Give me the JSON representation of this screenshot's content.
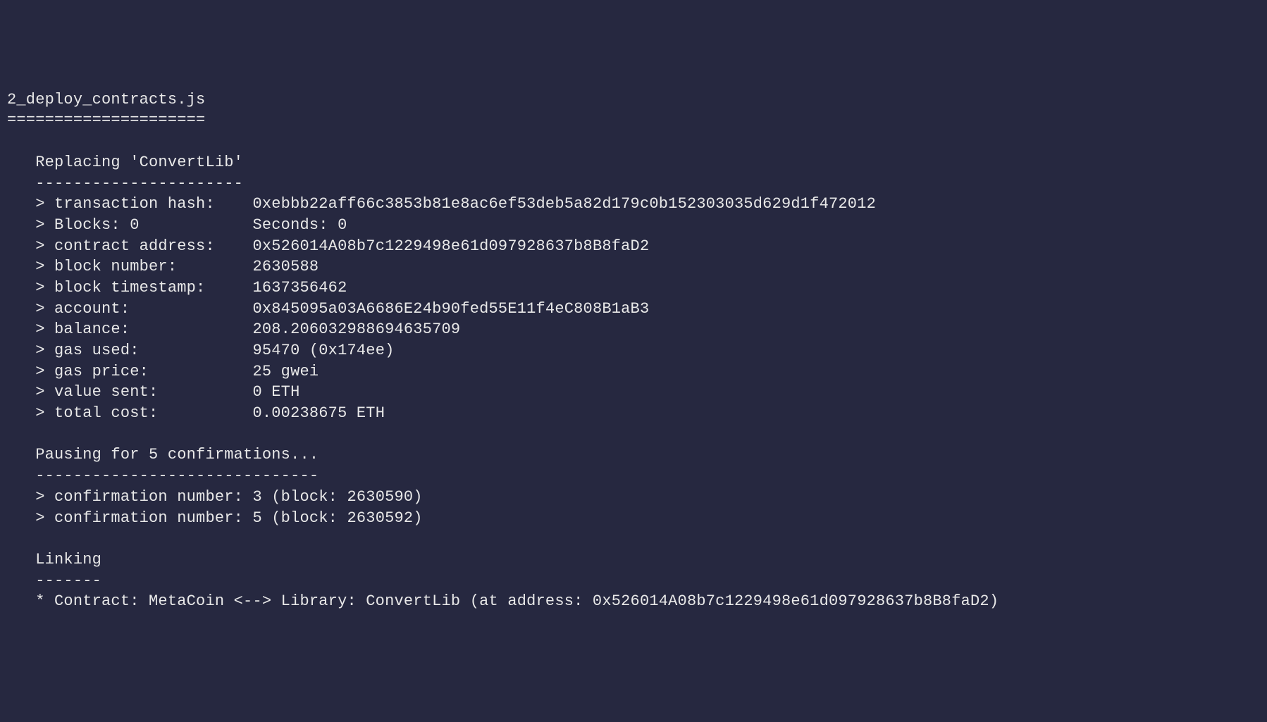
{
  "header": {
    "filename": "2_deploy_contracts.js",
    "underline": "====================="
  },
  "section_replacing": {
    "title": "   Replacing 'ConvertLib'",
    "underline": "   ----------------------",
    "rows": [
      {
        "label": "   > transaction hash:    ",
        "value": "0xebbb22aff66c3853b81e8ac6ef53deb5a82d179c0b152303035d629d1f472012"
      },
      {
        "label": "   > Blocks: 0            ",
        "value": "Seconds: 0"
      },
      {
        "label": "   > contract address:    ",
        "value": "0x526014A08b7c1229498e61d097928637b8B8faD2"
      },
      {
        "label": "   > block number:        ",
        "value": "2630588"
      },
      {
        "label": "   > block timestamp:     ",
        "value": "1637356462"
      },
      {
        "label": "   > account:             ",
        "value": "0x845095a03A6686E24b90fed55E11f4eC808B1aB3"
      },
      {
        "label": "   > balance:             ",
        "value": "208.206032988694635709"
      },
      {
        "label": "   > gas used:            ",
        "value": "95470 (0x174ee)"
      },
      {
        "label": "   > gas price:           ",
        "value": "25 gwei"
      },
      {
        "label": "   > value sent:          ",
        "value": "0 ETH"
      },
      {
        "label": "   > total cost:          ",
        "value": "0.00238675 ETH"
      }
    ]
  },
  "section_pausing": {
    "title": "   Pausing for 5 confirmations...",
    "underline": "   ------------------------------",
    "rows": [
      {
        "label": "   > confirmation number: ",
        "value": "3 (block: 2630590)"
      },
      {
        "label": "   > confirmation number: ",
        "value": "5 (block: 2630592)"
      }
    ]
  },
  "section_linking": {
    "title": "   Linking",
    "underline": "   -------",
    "line": "   * Contract: MetaCoin <--> Library: ConvertLib (at address: 0x526014A08b7c1229498e61d097928637b8B8faD2)"
  }
}
